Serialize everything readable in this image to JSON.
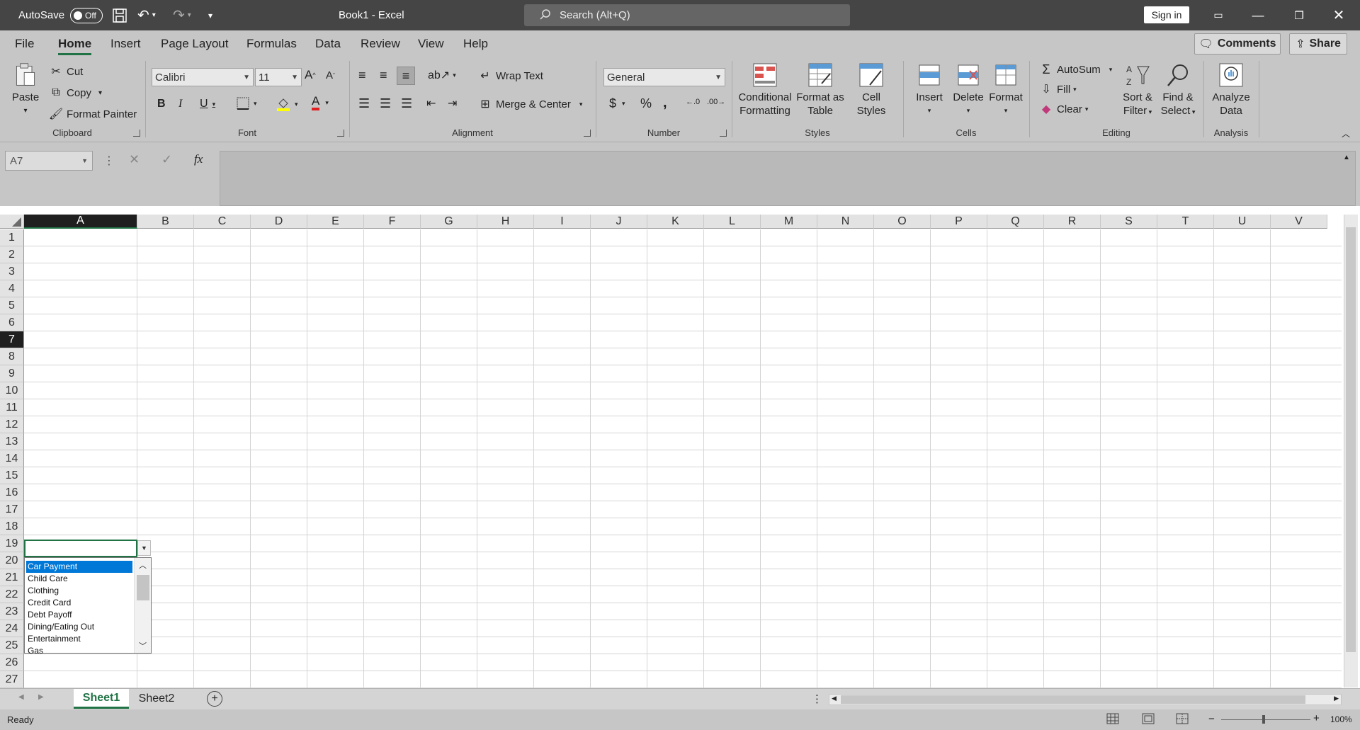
{
  "titlebar": {
    "autosave_label": "AutoSave",
    "autosave_state": "Off",
    "doc_title": "Book1  -  Excel",
    "search_placeholder": "Search (Alt+Q)",
    "signin": "Sign in"
  },
  "menu": {
    "file": "File",
    "home": "Home",
    "insert": "Insert",
    "page_layout": "Page Layout",
    "formulas": "Formulas",
    "data": "Data",
    "review": "Review",
    "view": "View",
    "help": "Help",
    "comments": "Comments",
    "share": "Share"
  },
  "ribbon": {
    "clipboard": {
      "paste": "Paste",
      "cut": "Cut",
      "copy": "Copy",
      "format_painter": "Format Painter",
      "label": "Clipboard"
    },
    "font": {
      "name": "Calibri",
      "size": "11",
      "label": "Font"
    },
    "alignment": {
      "wrap_text": "Wrap Text",
      "merge_center": "Merge & Center",
      "label": "Alignment"
    },
    "number": {
      "format": "General",
      "label": "Number"
    },
    "styles": {
      "conditional": "Conditional",
      "formatting": "Formatting",
      "format_as": "Format as",
      "table": "Table",
      "cell": "Cell",
      "styles": "Styles",
      "label": "Styles"
    },
    "cells": {
      "insert": "Insert",
      "delete": "Delete",
      "format": "Format",
      "label": "Cells"
    },
    "editing": {
      "autosum": "AutoSum",
      "fill": "Fill",
      "clear": "Clear",
      "sort": "Sort &",
      "filter": "Filter",
      "find": "Find &",
      "select": "Select",
      "label": "Editing"
    },
    "analysis": {
      "analyze": "Analyze",
      "data": "Data",
      "label": "Analysis"
    }
  },
  "formula_bar": {
    "name_box": "A7",
    "fx": "fx"
  },
  "grid": {
    "columns": [
      "A",
      "B",
      "C",
      "D",
      "E",
      "F",
      "G",
      "H",
      "I",
      "J",
      "K",
      "L",
      "M",
      "N",
      "O",
      "P",
      "Q",
      "R",
      "S",
      "T",
      "U",
      "V"
    ],
    "rows": [
      "1",
      "2",
      "3",
      "4",
      "5",
      "6",
      "7",
      "8",
      "9",
      "10",
      "11",
      "12",
      "13",
      "14",
      "15",
      "16",
      "17",
      "18",
      "19",
      "20",
      "21",
      "22",
      "23",
      "24",
      "25",
      "26",
      "27"
    ],
    "active_column": "A",
    "active_row": "7"
  },
  "dropdown": {
    "items": [
      "Car Payment",
      "Child Care",
      "Clothing",
      "Credit Card",
      "Debt Payoff",
      "Dining/Eating Out",
      "Entertainment",
      "Gas"
    ],
    "selected": "Car Payment"
  },
  "sheets": {
    "tabs": [
      "Sheet1",
      "Sheet2"
    ],
    "active": "Sheet1"
  },
  "status": {
    "mode": "Ready",
    "zoom": "100%"
  },
  "colors": {
    "accent": "#217346",
    "title_bg": "#454545",
    "ribbon_bg": "#c6c6c6",
    "selection": "#0078d7"
  }
}
